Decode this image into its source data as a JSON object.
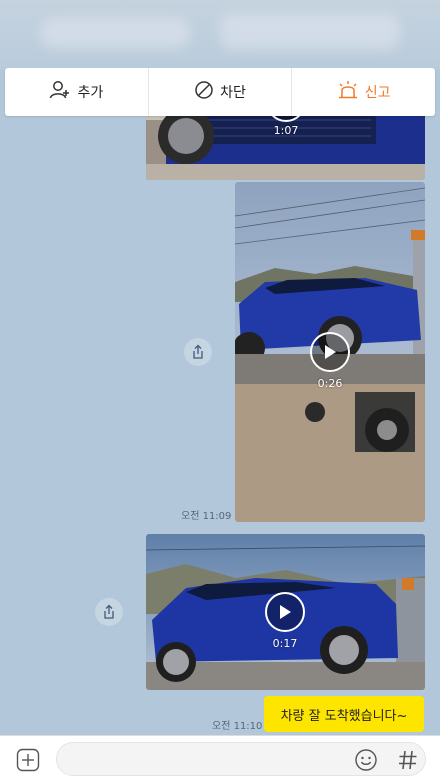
{
  "action_bar": {
    "add_label": "추가",
    "block_label": "차단",
    "report_label": "신고"
  },
  "messages": [
    {
      "type": "video",
      "duration": "1:07"
    },
    {
      "type": "video",
      "duration": "0:26",
      "time": "오전 11:09"
    },
    {
      "type": "video",
      "duration": "0:17"
    },
    {
      "type": "text",
      "text": "차량 잘 도착했습니다~",
      "time": "오전 11:10"
    }
  ],
  "input": {
    "placeholder": ""
  },
  "colors": {
    "chat_background": "#b2c7d9",
    "bubble_yellow": "#fee500",
    "report_orange": "#f07a2a"
  },
  "icons": [
    "add-friend-icon",
    "block-icon",
    "siren-icon",
    "share-icon",
    "play-icon",
    "plus-icon",
    "emoji-icon",
    "hash-icon"
  ]
}
